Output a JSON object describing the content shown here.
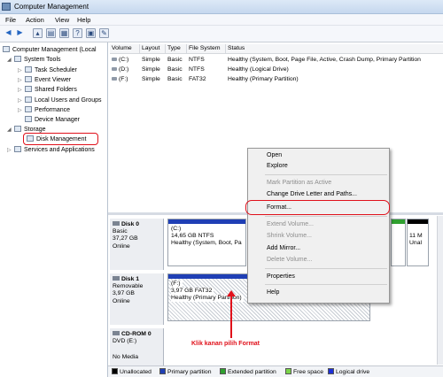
{
  "window": {
    "title": "Computer Management"
  },
  "menu": {
    "items": [
      "File",
      "Action",
      "View",
      "Help"
    ]
  },
  "toolbar": {
    "buttons": [
      "back",
      "forward",
      "up",
      "show-hide-tree",
      "properties",
      "help",
      "console",
      "settings"
    ]
  },
  "tree": {
    "root": "Computer Management (Local",
    "system_tools": "System Tools",
    "task_scheduler": "Task Scheduler",
    "event_viewer": "Event Viewer",
    "shared_folders": "Shared Folders",
    "local_users": "Local Users and Groups",
    "performance": "Performance",
    "device_manager": "Device Manager",
    "storage": "Storage",
    "disk_management": "Disk Management",
    "services": "Services and Applications"
  },
  "volumes": {
    "headers": {
      "volume": "Volume",
      "layout": "Layout",
      "type": "Type",
      "fs": "File System",
      "status": "Status"
    },
    "rows": [
      {
        "volume": "(C:)",
        "layout": "Simple",
        "type": "Basic",
        "fs": "NTFS",
        "status": "Healthy (System, Boot, Page File, Active, Crash Dump, Primary Partition"
      },
      {
        "volume": "(D:)",
        "layout": "Simple",
        "type": "Basic",
        "fs": "NTFS",
        "status": "Healthy (Logical Drive)"
      },
      {
        "volume": "(F:)",
        "layout": "Simple",
        "type": "Basic",
        "fs": "FAT32",
        "status": "Healthy (Primary Partition)"
      }
    ]
  },
  "disks": {
    "disk0": {
      "name": "Disk 0",
      "type": "Basic",
      "size": "37,27 GB",
      "state": "Online",
      "p1": {
        "label": "(C:)",
        "size": "14,65 GB NTFS",
        "status": "Healthy (System, Boot, Pa"
      },
      "p2": {
        "label": "11 M",
        "status": "Unal"
      }
    },
    "disk1": {
      "name": "Disk 1",
      "type": "Removable",
      "size": "3,97 GB",
      "state": "Online",
      "p1": {
        "label": "(F:)",
        "size": "3,97 GB FAT32",
        "status": "Healthy (Primary Partition)"
      }
    },
    "cdrom": {
      "name": "CD-ROM 0",
      "type": "DVD (E:)",
      "state": "No Media"
    }
  },
  "legend": {
    "unallocated": "Unallocated",
    "primary": "Primary partition",
    "extended": "Extended partition",
    "free": "Free space",
    "logical": "Logical drive",
    "colors": {
      "unallocated": "#000000",
      "primary": "#1f3fb5",
      "extended": "#2fa02f",
      "free": "#7ad44a",
      "logical": "#1c2fd8"
    }
  },
  "context_menu": {
    "open": "Open",
    "explore": "Explore",
    "mark_active": "Mark Partition as Active",
    "change_letter": "Change Drive Letter and Paths...",
    "format": "Format...",
    "extend": "Extend Volume...",
    "shrink": "Shrink Volume...",
    "add_mirror": "Add Mirror...",
    "delete": "Delete Volume...",
    "properties": "Properties",
    "help": "Help"
  },
  "annotation": "Klik kanan pilih Format"
}
